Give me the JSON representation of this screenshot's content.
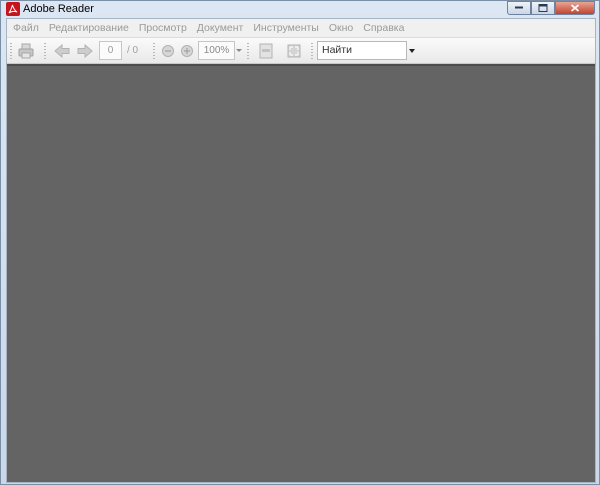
{
  "window": {
    "title": "Adobe Reader"
  },
  "menu": {
    "items": [
      "Файл",
      "Редактирование",
      "Просмотр",
      "Документ",
      "Инструменты",
      "Окно",
      "Справка"
    ]
  },
  "toolbar": {
    "icons": [
      "print-icon",
      "back-arrow-icon",
      "forward-arrow-icon",
      "zoom-out-icon",
      "zoom-in-icon",
      "fit-page-icon",
      "fullscreen-icon"
    ],
    "page_number": "0",
    "page_total": "/ 0",
    "zoom": "100%",
    "search_text": "Найти"
  },
  "colors": {
    "document_background": "#646464",
    "title_icon": "#c4161c",
    "disabled_text": "#9a9a9a"
  }
}
